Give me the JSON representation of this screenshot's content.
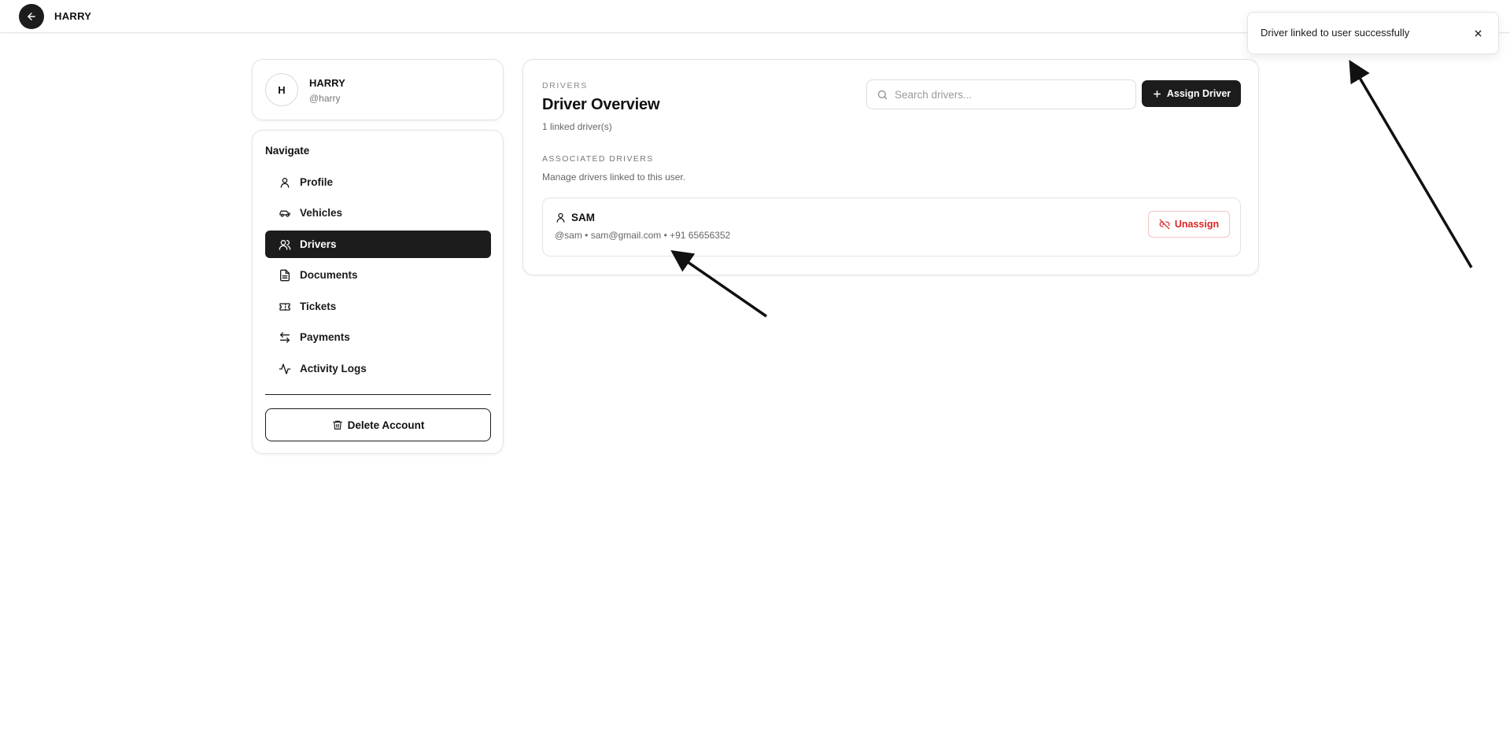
{
  "header": {
    "title": "HARRY",
    "back_icon": "arrow-left-icon"
  },
  "profile": {
    "initial": "H",
    "name": "HARRY",
    "handle": "@harry"
  },
  "nav": {
    "title": "Navigate",
    "items": [
      {
        "label": "Profile",
        "icon": "user-icon",
        "active": false
      },
      {
        "label": "Vehicles",
        "icon": "car-icon",
        "active": false
      },
      {
        "label": "Drivers",
        "icon": "users-icon",
        "active": true
      },
      {
        "label": "Documents",
        "icon": "document-icon",
        "active": false
      },
      {
        "label": "Tickets",
        "icon": "ticket-icon",
        "active": false
      },
      {
        "label": "Payments",
        "icon": "transfer-arrows-icon",
        "active": false
      },
      {
        "label": "Activity Logs",
        "icon": "activity-icon",
        "active": false
      }
    ],
    "delete_label": "Delete Account"
  },
  "main": {
    "kicker": "DRIVERS",
    "title": "Driver Overview",
    "linked_count": "1 linked driver(s)",
    "search": {
      "placeholder": "Search drivers...",
      "value": ""
    },
    "assign_label": "Assign Driver",
    "assoc_kicker": "ASSOCIATED DRIVERS",
    "assoc_desc": "Manage drivers linked to this user.",
    "drivers": [
      {
        "name": "SAM",
        "meta": "@sam • sam@gmail.com • +91 65656352",
        "action": "Unassign"
      }
    ]
  },
  "toast": {
    "message": "Driver linked to user successfully"
  },
  "colors": {
    "primary": "#1c1c1c",
    "danger": "#dc2626",
    "muted": "#666666",
    "border": "#e3e3e3"
  }
}
